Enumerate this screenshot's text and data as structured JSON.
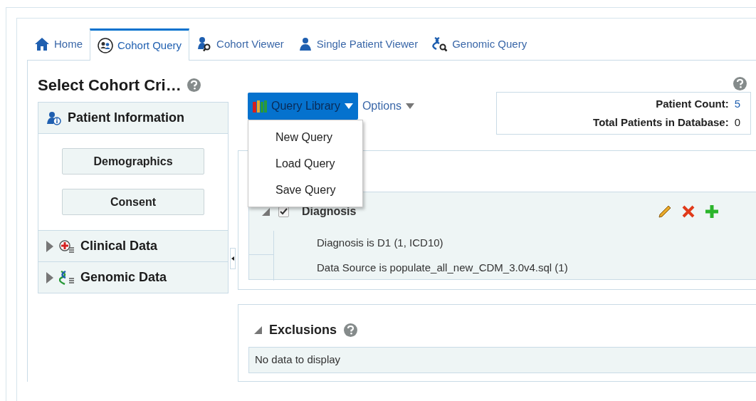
{
  "tabs": [
    {
      "label": "Home",
      "kind": "home",
      "selected": false
    },
    {
      "label": "Cohort Query",
      "kind": "group",
      "selected": true
    },
    {
      "label": "Cohort Viewer",
      "kind": "viewer",
      "selected": false
    },
    {
      "label": "Single Patient Viewer",
      "kind": "person",
      "selected": false
    },
    {
      "label": "Genomic Query",
      "kind": "genomic",
      "selected": false
    }
  ],
  "page_title": "Select Cohort Cri…",
  "sidebar": {
    "sections": [
      {
        "title": "Patient Information",
        "kind": "info",
        "expanded": true,
        "buttons": [
          "Demographics",
          "Consent"
        ]
      },
      {
        "title": "Clinical Data",
        "kind": "clinical",
        "expanded": false
      },
      {
        "title": "Genomic Data",
        "kind": "genomic",
        "expanded": false
      }
    ]
  },
  "toolbar": {
    "query_library": "Query Library",
    "options": "Options",
    "menu": [
      "New Query",
      "Load Query",
      "Save Query"
    ]
  },
  "counts": [
    {
      "label": "Patient Count:",
      "value": "5"
    },
    {
      "label": "Total Patients in Database:",
      "value": "0"
    }
  ],
  "inclusions": {
    "criteria": [
      {
        "title": "Diagnosis",
        "checked": true,
        "expanded": true,
        "details": [
          "Diagnosis is D1 (1, ICD10)",
          "Data Source is populate_all_new_CDM_3.0v4.sql (1)"
        ]
      }
    ]
  },
  "exclusions": {
    "title": "Exclusions",
    "expanded": true,
    "empty_text": "No data to display"
  }
}
